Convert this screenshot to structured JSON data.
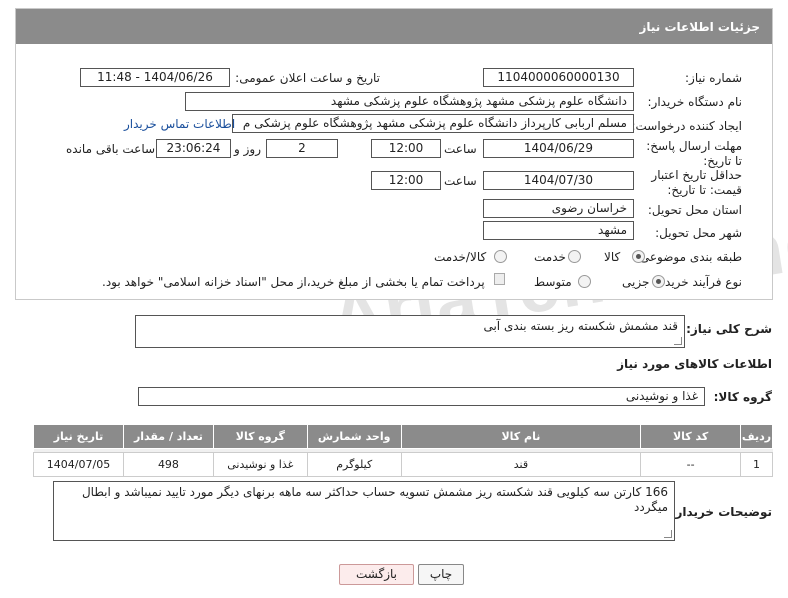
{
  "panel": {
    "title": "جزئیات اطلاعات نیاز"
  },
  "watermark": "AriaTender.net",
  "fields": {
    "need_number_label": "شماره نیاز:",
    "need_number": "1104000060000130",
    "announce_label": "تاریخ و ساعت اعلان عمومی:",
    "announce_value": "1404/06/26 - 11:48",
    "buyer_org_label": "نام دستگاه خریدار:",
    "buyer_org": "دانشگاه علوم پزشکی مشهد   پژوهشگاه علوم پزشکی مشهد",
    "creator_label": "ایجاد کننده درخواست:",
    "creator": "مسلم اربابی کارپرداز دانشگاه علوم پزشکی مشهد   پژوهشگاه علوم پزشکی م",
    "contact_link": "اطلاعات تماس خریدار",
    "deadline_label": "مهلت ارسال پاسخ: تا تاریخ:",
    "deadline_date": "1404/06/29",
    "time_label": "ساعت",
    "deadline_time": "12:00",
    "days_value": "2",
    "days_label": "روز و",
    "remaining_time": "23:06:24",
    "remaining_label": "ساعت باقی مانده",
    "price_valid_label": "حداقل تاریخ اعتبار قیمت: تا تاریخ:",
    "price_valid_date": "1404/07/30",
    "price_valid_time": "12:00",
    "province_label": "استان محل تحویل:",
    "province": "خراسان رضوی",
    "city_label": "شهر محل تحویل:",
    "city": "مشهد",
    "category_label": "طبقه بندی موضوعی:",
    "category_options": [
      "کالا",
      "خدمت",
      "کالا/خدمت"
    ],
    "purchase_type_label": "نوع فرآیند خرید :",
    "purchase_options": [
      "جزیی",
      "متوسط"
    ],
    "payment_text": "پرداخت تمام یا بخشی از مبلغ خرید،از محل \"اسناد خزانه اسلامی\" خواهد بود."
  },
  "description": {
    "label": "شرح کلی نیاز:",
    "value": "قند مشمش شکسته ریز بسته بندی آبی"
  },
  "goods_info": {
    "title": "اطلاعات کالاهای مورد نیاز"
  },
  "goods_group": {
    "label": "گروه کالا:",
    "value": "غذا و نوشیدنی"
  },
  "table": {
    "headers": [
      "ردیف",
      "کد کالا",
      "نام کالا",
      "واحد شمارش",
      "گروه کالا",
      "تعداد / مقدار",
      "تاریخ نیاز"
    ],
    "rows": [
      [
        "1",
        "--",
        "قند",
        "کیلوگرم",
        "غذا و نوشیدنی",
        "498",
        "1404/07/05"
      ]
    ]
  },
  "buyer_notes": {
    "label": "توضیحات خریدار:",
    "value": "166 کارتن سه کیلویی قند شکسته ریز مشمش تسویه حساب حداکثر سه ماهه برنهای دیگر مورد تایید نمیباشد و ابطال میگردد"
  },
  "buttons": {
    "print": "چاپ",
    "back": "بازگشت"
  }
}
